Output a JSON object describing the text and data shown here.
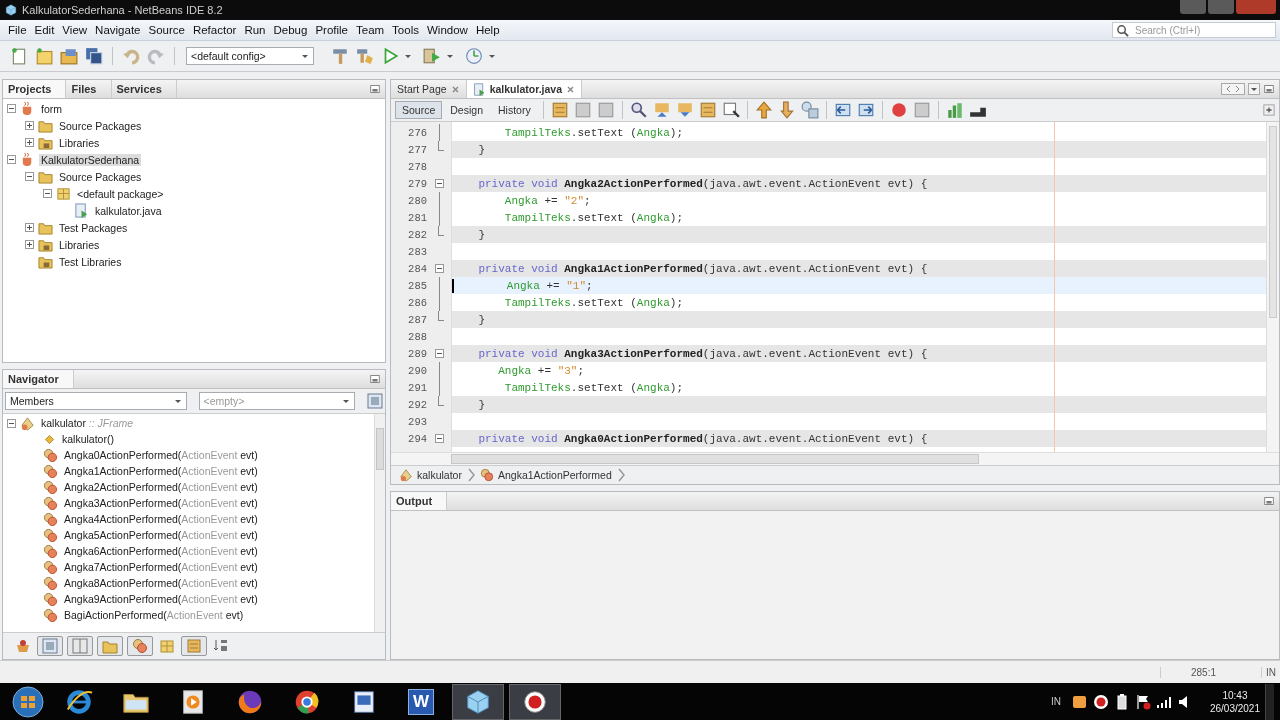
{
  "window": {
    "title": "KalkulatorSederhana - NetBeans IDE 8.2"
  },
  "menu": [
    "File",
    "Edit",
    "View",
    "Navigate",
    "Source",
    "Refactor",
    "Run",
    "Debug",
    "Profile",
    "Team",
    "Tools",
    "Window",
    "Help"
  ],
  "search": {
    "placeholder": "Search (Ctrl+I)"
  },
  "toolbar": {
    "config": "<default config>"
  },
  "projects_panel": {
    "tabs": [
      {
        "label": "Projects",
        "selected": true
      },
      {
        "label": "Files",
        "selected": false
      },
      {
        "label": "Services",
        "selected": false
      }
    ],
    "tree": [
      {
        "label": "form",
        "kind": "project",
        "expanded": true,
        "selected": false,
        "children": [
          {
            "label": "Source Packages",
            "kind": "folder",
            "expanded": false,
            "selected": false
          },
          {
            "label": "Libraries",
            "kind": "library",
            "expanded": false,
            "selected": false
          }
        ]
      },
      {
        "label": "KalkulatorSederhana",
        "kind": "project",
        "expanded": true,
        "selected": true,
        "children": [
          {
            "label": "Source Packages",
            "kind": "folder",
            "expanded": true,
            "selected": false,
            "children": [
              {
                "label": "<default package>",
                "kind": "package",
                "expanded": true,
                "selected": false,
                "children": [
                  {
                    "label": "kalkulator.java",
                    "kind": "java",
                    "selected": false
                  }
                ]
              }
            ]
          },
          {
            "label": "Test Packages",
            "kind": "folder",
            "expanded": false,
            "selected": false
          },
          {
            "label": "Libraries",
            "kind": "library",
            "expanded": false,
            "selected": false
          },
          {
            "label": "Test Libraries",
            "kind": "library",
            "selected": false
          }
        ]
      }
    ]
  },
  "navigator": {
    "title": "Navigator",
    "filter": "Members",
    "scope": "<empty>",
    "root": {
      "name": "kalkulator",
      "type": ":: JFrame",
      "expanded": true
    },
    "members": [
      {
        "kind": "constructor",
        "name": "kalkulator()"
      },
      {
        "kind": "method",
        "name": "Angka0ActionPerformed(",
        "param_type": "ActionEvent",
        "param_name": " evt)"
      },
      {
        "kind": "method",
        "name": "Angka1ActionPerformed(",
        "param_type": "ActionEvent",
        "param_name": " evt)"
      },
      {
        "kind": "method",
        "name": "Angka2ActionPerformed(",
        "param_type": "ActionEvent",
        "param_name": " evt)"
      },
      {
        "kind": "method",
        "name": "Angka3ActionPerformed(",
        "param_type": "ActionEvent",
        "param_name": " evt)"
      },
      {
        "kind": "method",
        "name": "Angka4ActionPerformed(",
        "param_type": "ActionEvent",
        "param_name": " evt)"
      },
      {
        "kind": "method",
        "name": "Angka5ActionPerformed(",
        "param_type": "ActionEvent",
        "param_name": " evt)"
      },
      {
        "kind": "method",
        "name": "Angka6ActionPerformed(",
        "param_type": "ActionEvent",
        "param_name": " evt)"
      },
      {
        "kind": "method",
        "name": "Angka7ActionPerformed(",
        "param_type": "ActionEvent",
        "param_name": " evt)"
      },
      {
        "kind": "method",
        "name": "Angka8ActionPerformed(",
        "param_type": "ActionEvent",
        "param_name": " evt)"
      },
      {
        "kind": "method",
        "name": "Angka9ActionPerformed(",
        "param_type": "ActionEvent",
        "param_name": " evt)"
      },
      {
        "kind": "method",
        "name": "BagiActionPerformed(",
        "param_type": "ActionEvent",
        "param_name": " evt)"
      }
    ]
  },
  "editor": {
    "tabs": [
      {
        "label": "Start Page",
        "kind": "page",
        "selected": false
      },
      {
        "label": "kalkulator.java",
        "kind": "java",
        "selected": true
      }
    ],
    "views": [
      {
        "label": "Source",
        "selected": true
      },
      {
        "label": "Design",
        "selected": false
      },
      {
        "label": "History",
        "selected": false
      }
    ],
    "lines": [
      {
        "number": "276",
        "kind": "fold-body",
        "shaded": false,
        "current": false,
        "tokens": [
          {
            "kind": "field",
            "text": "        TampilTeks"
          },
          {
            "kind": "plain",
            "text": ".setText ("
          },
          {
            "kind": "field",
            "text": "Angka"
          },
          {
            "kind": "plain",
            "text": ");"
          }
        ]
      },
      {
        "number": "277",
        "kind": "fold-end",
        "shaded": true,
        "current": false,
        "tokens": [
          {
            "kind": "plain",
            "text": "    }"
          }
        ]
      },
      {
        "number": "278",
        "kind": "blank",
        "shaded": false,
        "current": false
      },
      {
        "number": "279",
        "kind": "fold-start",
        "shaded": true,
        "current": false,
        "tokens": [
          {
            "kind": "keyword",
            "text": "    private void "
          },
          {
            "kind": "method",
            "text": "Angka2ActionPerformed"
          },
          {
            "kind": "plain",
            "text": "(java.awt.event.ActionEvent evt) {"
          }
        ]
      },
      {
        "number": "280",
        "kind": "fold-body",
        "shaded": false,
        "current": false,
        "tokens": [
          {
            "kind": "field",
            "text": "        Angka"
          },
          {
            "kind": "plain",
            "text": " += "
          },
          {
            "kind": "string",
            "text": "\"2\""
          },
          {
            "kind": "plain",
            "text": ";"
          }
        ]
      },
      {
        "number": "281",
        "kind": "fold-body",
        "shaded": false,
        "current": false,
        "tokens": [
          {
            "kind": "field",
            "text": "        TampilTeks"
          },
          {
            "kind": "plain",
            "text": ".setText ("
          },
          {
            "kind": "field",
            "text": "Angka"
          },
          {
            "kind": "plain",
            "text": ");"
          }
        ]
      },
      {
        "number": "282",
        "kind": "fold-end",
        "shaded": true,
        "current": false,
        "tokens": [
          {
            "kind": "plain",
            "text": "    }"
          }
        ]
      },
      {
        "number": "283",
        "kind": "blank",
        "shaded": false,
        "current": false
      },
      {
        "number": "284",
        "kind": "fold-start",
        "shaded": true,
        "current": false,
        "tokens": [
          {
            "kind": "keyword",
            "text": "    private void "
          },
          {
            "kind": "method",
            "text": "Angka1ActionPerformed"
          },
          {
            "kind": "plain",
            "text": "(java.awt.event.ActionEvent evt) {"
          }
        ]
      },
      {
        "number": "285",
        "kind": "fold-body",
        "shaded": false,
        "current": true,
        "tokens": [
          {
            "kind": "field",
            "text": "        Angka"
          },
          {
            "kind": "plain",
            "text": " += "
          },
          {
            "kind": "string",
            "text": "\"1\""
          },
          {
            "kind": "plain",
            "text": ";"
          }
        ]
      },
      {
        "number": "286",
        "kind": "fold-body",
        "shaded": false,
        "current": false,
        "tokens": [
          {
            "kind": "field",
            "text": "        TampilTeks"
          },
          {
            "kind": "plain",
            "text": ".setText ("
          },
          {
            "kind": "field",
            "text": "Angka"
          },
          {
            "kind": "plain",
            "text": ");"
          }
        ]
      },
      {
        "number": "287",
        "kind": "fold-end",
        "shaded": true,
        "current": false,
        "tokens": [
          {
            "kind": "plain",
            "text": "    }"
          }
        ]
      },
      {
        "number": "288",
        "kind": "blank",
        "shaded": false,
        "current": false
      },
      {
        "number": "289",
        "kind": "fold-start",
        "shaded": true,
        "current": false,
        "tokens": [
          {
            "kind": "keyword",
            "text": "    private void "
          },
          {
            "kind": "method",
            "text": "Angka3ActionPerformed"
          },
          {
            "kind": "plain",
            "text": "(java.awt.event.ActionEvent evt) {"
          }
        ]
      },
      {
        "number": "290",
        "kind": "fold-body",
        "shaded": false,
        "current": false,
        "tokens": [
          {
            "kind": "field",
            "text": "       Angka"
          },
          {
            "kind": "plain",
            "text": " += "
          },
          {
            "kind": "string",
            "text": "\"3\""
          },
          {
            "kind": "plain",
            "text": ";"
          }
        ]
      },
      {
        "number": "291",
        "kind": "fold-body",
        "shaded": false,
        "current": false,
        "tokens": [
          {
            "kind": "field",
            "text": "        TampilTeks"
          },
          {
            "kind": "plain",
            "text": ".setText ("
          },
          {
            "kind": "field",
            "text": "Angka"
          },
          {
            "kind": "plain",
            "text": ");"
          }
        ]
      },
      {
        "number": "292",
        "kind": "fold-end",
        "shaded": true,
        "current": false,
        "tokens": [
          {
            "kind": "plain",
            "text": "    }"
          }
        ]
      },
      {
        "number": "293",
        "kind": "blank",
        "shaded": false,
        "current": false
      },
      {
        "number": "294",
        "kind": "fold-start",
        "shaded": true,
        "current": false,
        "tokens": [
          {
            "kind": "keyword",
            "text": "    private void "
          },
          {
            "kind": "method",
            "text": "Angka0ActionPerformed"
          },
          {
            "kind": "plain",
            "text": "(java.awt.event.ActionEvent evt) {"
          }
        ]
      }
    ],
    "breadcrumb": [
      {
        "kind": "class",
        "label": "kalkulator"
      },
      {
        "kind": "method",
        "label": "Angka1ActionPerformed"
      }
    ]
  },
  "output": {
    "title": "Output"
  },
  "status_bar": {
    "position": "285:1",
    "mode": "IN"
  },
  "taskbar": {
    "items": [
      {
        "kind": "browser-e",
        "active": false
      },
      {
        "kind": "folder",
        "active": false
      },
      {
        "kind": "media",
        "active": false
      },
      {
        "kind": "fox",
        "active": false
      },
      {
        "kind": "chrome",
        "active": false
      },
      {
        "kind": "app",
        "active": false
      },
      {
        "kind": "word",
        "glyph": "W",
        "active": false
      },
      {
        "kind": "cube",
        "active": true
      },
      {
        "kind": "recorder",
        "active": true
      }
    ],
    "tray": {
      "language": "IN",
      "time": "10:43",
      "date": "26/03/2021"
    }
  }
}
